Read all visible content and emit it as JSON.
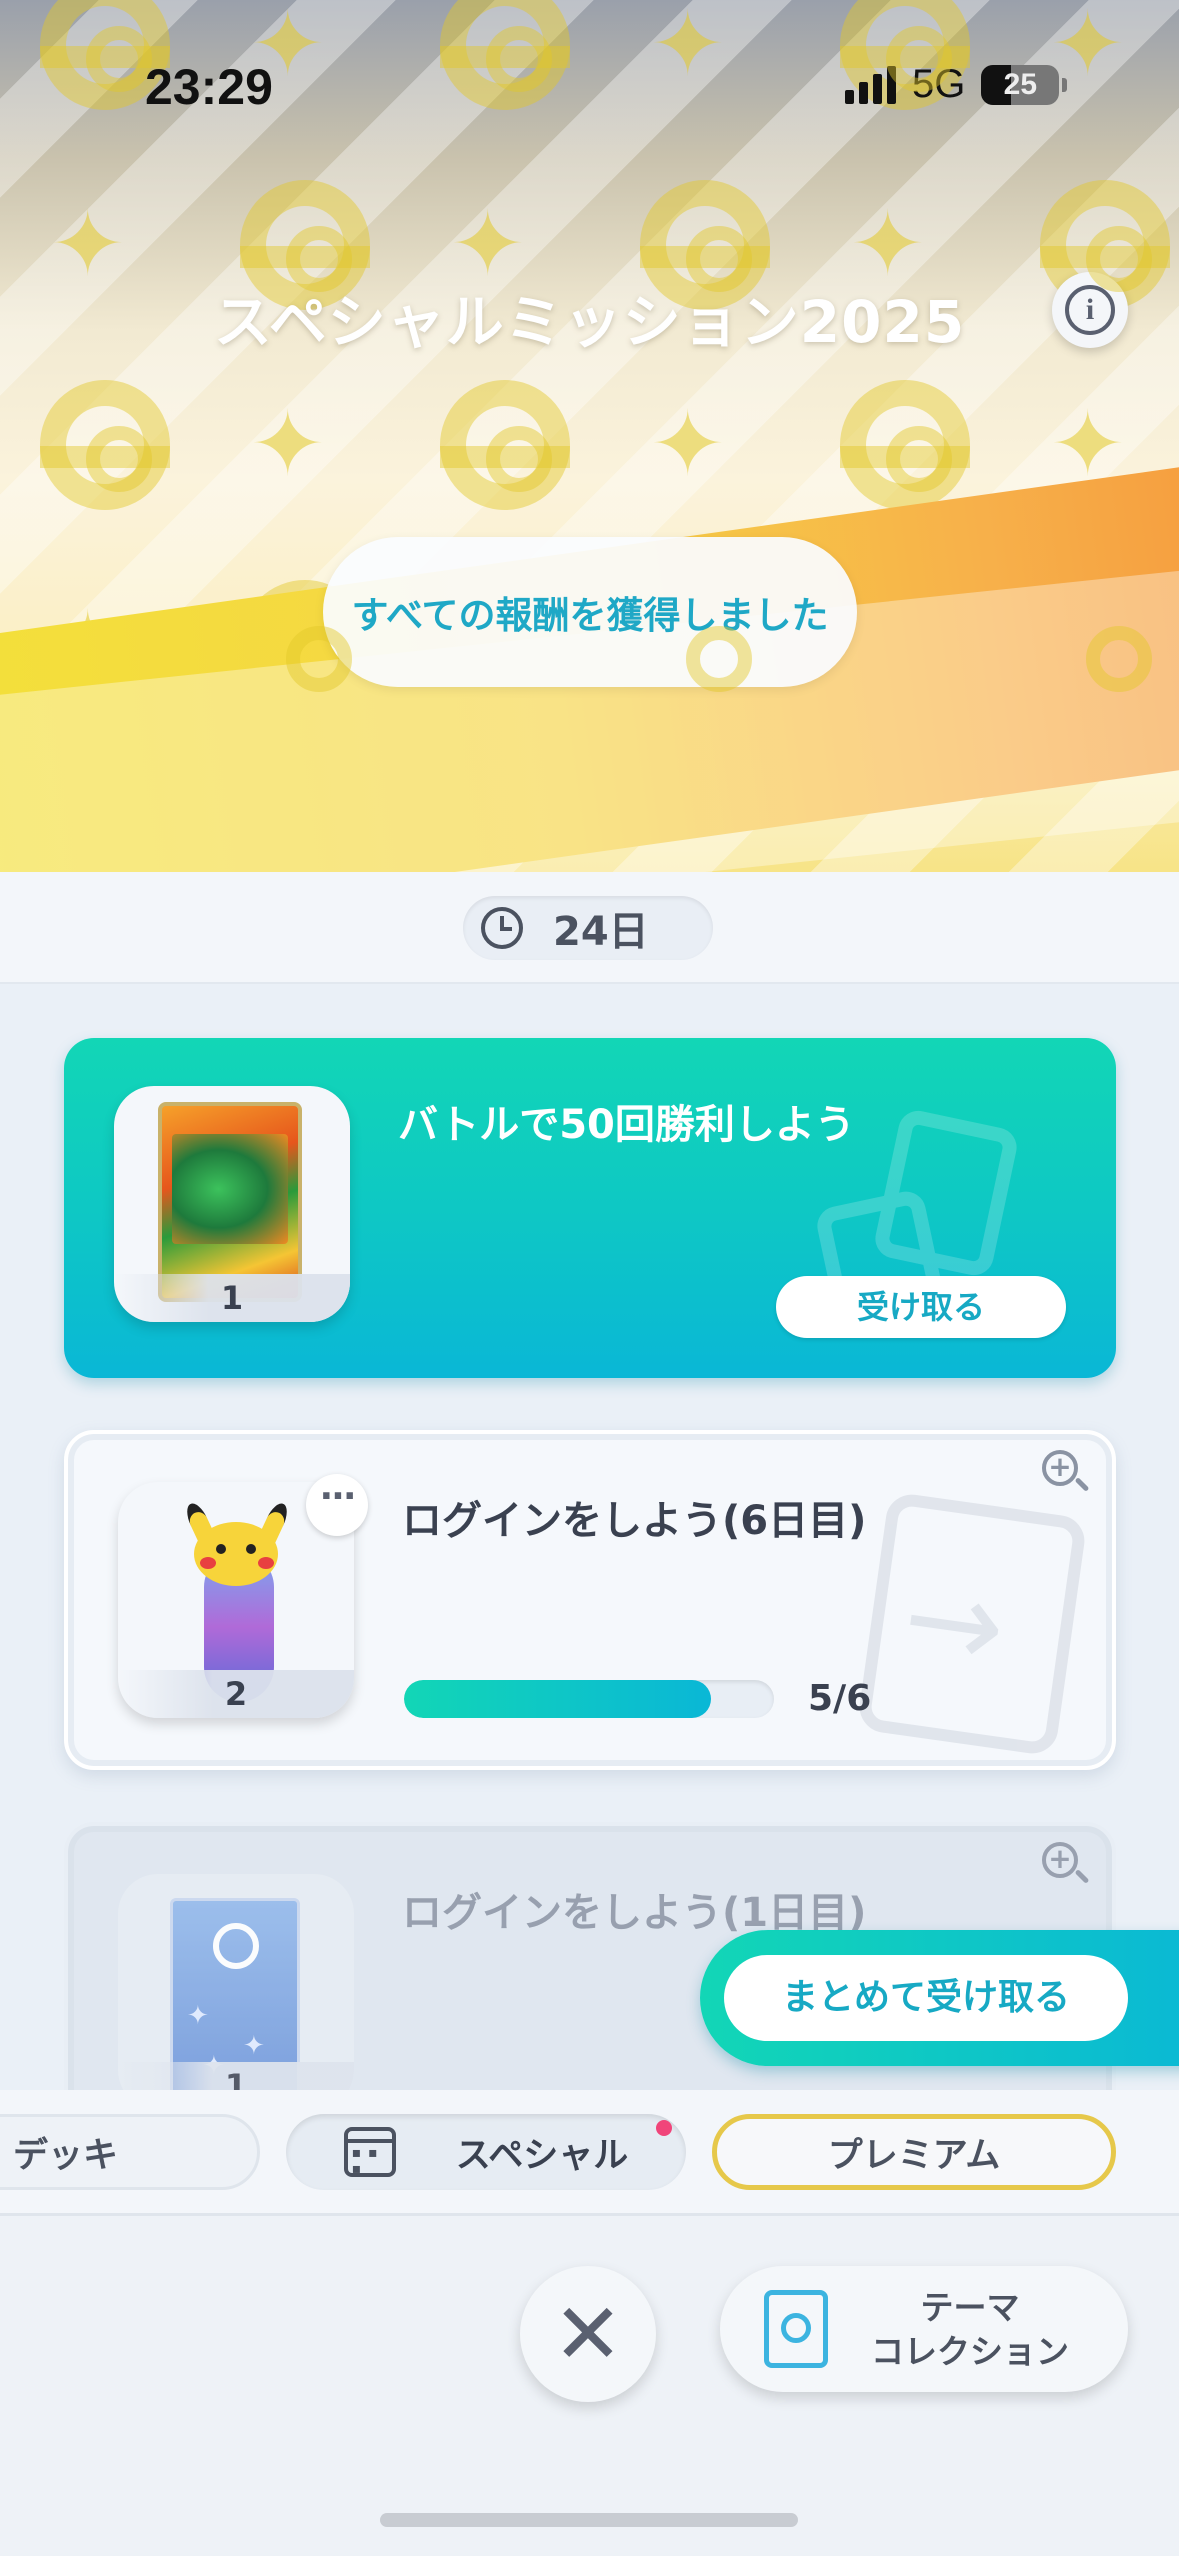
{
  "status_bar": {
    "time": "23:29",
    "network": "5G",
    "battery": "25"
  },
  "header": {
    "title": "スペシャルミッション2025",
    "rewards_status": "すべての報酬を獲得しました"
  },
  "timer": {
    "remaining": "24日"
  },
  "missions": [
    {
      "title": "バトルで50回勝利しよう",
      "reward_count": "1",
      "action_label": "受け取る",
      "state": "claimable"
    },
    {
      "title": "ログインをしよう(6日目)",
      "reward_count": "2",
      "progress_text": "5/6",
      "progress_fraction": 0.83,
      "state": "in-progress"
    },
    {
      "title": "ログインをしよう(1日目)",
      "reward_count": "1",
      "state": "completed"
    }
  ],
  "claim_all_label": "まとめて受け取る",
  "tabs": [
    {
      "label": "デッキ"
    },
    {
      "label": "スペシャル",
      "selected": true,
      "badge": true
    },
    {
      "label": "プレミアム"
    }
  ],
  "bottom": {
    "theme_label_line1": "テーマ",
    "theme_label_line2": "コレクション"
  },
  "colors": {
    "accent": "#0ec8c4",
    "accent_text": "#17a9c4",
    "premium_border": "#e6c84a",
    "badge": "#f0457a"
  }
}
